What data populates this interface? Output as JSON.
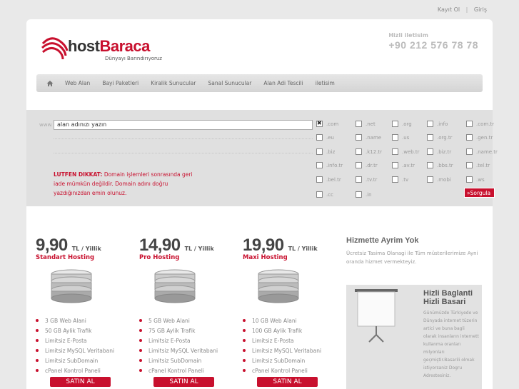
{
  "top_links": {
    "register": "Kayıt Ol",
    "separator": "|",
    "login": "Giriş"
  },
  "logo": {
    "brand_prefix": "host",
    "brand_suffix": "Baraca",
    "tagline": "Dünyayı Barındırıyoruz"
  },
  "contact": {
    "label": "Hizli iletisim",
    "phone": "+90 212 576 78 78"
  },
  "nav": {
    "home_icon": "home-icon",
    "items": [
      "Web Alan",
      "Bayi Paketleri",
      "Kiralik Sunucular",
      "Sanal Sunucular",
      "Alan Adi Tescili",
      "iletisim"
    ]
  },
  "domain_search": {
    "prefix": "www.",
    "input_value": "alan adınızı yazın",
    "notice_bold": "LUTFEN DIKKAT:",
    "notice_text": "Domain işlemleri sonrasında geri iade mümkün değildir. Domain adını doğru yazdığınızdan emin olunuz.",
    "submit_label": "»Sorgula",
    "tlds": [
      [
        {
          "label": ".com",
          "checked": true
        },
        {
          "label": ".net"
        },
        {
          "label": ".org"
        },
        {
          "label": ".info"
        },
        {
          "label": ".com.tr"
        }
      ],
      [
        {
          "label": ".eu"
        },
        {
          "label": ".name"
        },
        {
          "label": ".us"
        },
        {
          "label": ".org.tr"
        },
        {
          "label": ".gen.tr"
        }
      ],
      [
        {
          "label": ".biz"
        },
        {
          "label": ".k12.tr"
        },
        {
          "label": ".web.tr"
        },
        {
          "label": ".biz.tr"
        },
        {
          "label": ".name.tr"
        }
      ],
      [
        {
          "label": ".info.tr"
        },
        {
          "label": ".dr.tr"
        },
        {
          "label": ".av.tr"
        },
        {
          "label": ".bbs.tr"
        },
        {
          "label": ".tel.tr"
        }
      ],
      [
        {
          "label": ".bel.tr"
        },
        {
          "label": ".tv.tr"
        },
        {
          "label": ".tv"
        },
        {
          "label": ".mobi"
        },
        {
          "label": ".ws"
        }
      ],
      [
        {
          "label": ".cc"
        },
        {
          "label": ".in"
        }
      ]
    ]
  },
  "plans": [
    {
      "price": "9,90",
      "unit": "TL / Yillik",
      "name": "Standart Hosting",
      "features": [
        "3 GB Web Alani",
        "50 GB Aylik Trafik",
        "Limitsiz E-Posta",
        "Limitsiz MySQL Veritabani",
        "Limitsiz SubDomain",
        "cPanel Kontrol Paneli"
      ],
      "buy_label": "SATIN AL"
    },
    {
      "price": "14,90",
      "unit": "TL / Yillik",
      "name": "Pro Hosting",
      "features": [
        "5 GB Web Alani",
        "75 GB Aylik Trafik",
        "Limitsiz E-Posta",
        "Limitsiz MySQL Veritabani",
        "Limitsiz SubDomain",
        "cPanel Kontrol Paneli"
      ],
      "buy_label": "SATIN AL"
    },
    {
      "price": "19,90",
      "unit": "TL / Yillik",
      "name": "Maxi Hosting",
      "features": [
        "10 GB Web Alani",
        "100 GB Aylik Trafik",
        "Limitsiz E-Posta",
        "Limitsiz MySQL Veritabani",
        "Limitsiz SubDomain",
        "cPanel Kontrol Paneli"
      ],
      "buy_label": "SATIN AL"
    }
  ],
  "service": {
    "title": "Hizmette Ayrim Yok",
    "text": "Ücretsiz Tasima Olanagi ile Tüm müsterilerimize Ayni oranda hizmet vermekteyiz."
  },
  "fast": {
    "title_line1": "Hizli Baglanti",
    "title_line2": "Hizli Basari",
    "text": "Günümüzde Türkiyede ve Dünyada internet tüzerin artici ve buna bagli olarak insanların internett kullanma oranları milyonları geçmiştir.Basarili olmak istiyorsaniz Dogru Adrestesiniz."
  },
  "colors": {
    "accent": "#c8102e",
    "background": "#e9e9e9",
    "panel": "#e0e0e0"
  }
}
